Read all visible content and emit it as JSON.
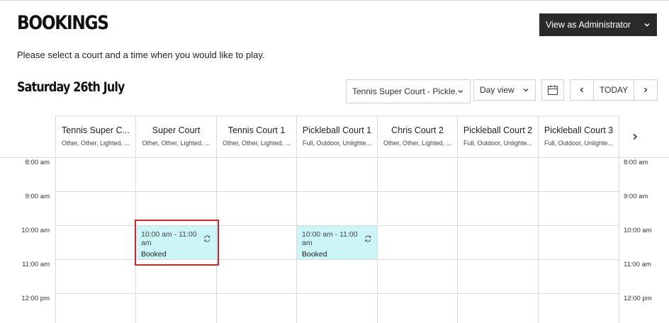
{
  "header": {
    "title": "BOOKINGS",
    "subtitle": "Please select a court and a time when you would like to play.",
    "admin_label": "View as Administrator"
  },
  "toolbar": {
    "date": "Saturday 26th July",
    "court_select_value": "Tennis Super Court - Pickle...",
    "view_select_value": "Day view",
    "today_label": "TODAY",
    "prev_icon": "chevron-left-icon",
    "next_icon": "chevron-right-icon",
    "calendar_icon": "calendar-icon"
  },
  "columns": [
    {
      "name": "Tennis Super C...",
      "meta": "Other, Other, Lighted, ..."
    },
    {
      "name": "Super Court",
      "meta": "Other, Other, Lighted, ..."
    },
    {
      "name": "Tennis Court 1",
      "meta": "Other, Other, Lighted, ..."
    },
    {
      "name": "Pickleball Court 1",
      "meta": "Full, Outdoor, Unlighte..."
    },
    {
      "name": "Chris Court 2",
      "meta": "Other, Other, Lighted, ..."
    },
    {
      "name": "Pickleball Court 2",
      "meta": "Full, Outdoor, Unlighte..."
    },
    {
      "name": "Pickleball Court 3",
      "meta": "Full, Outdoor, Unlighte..."
    }
  ],
  "times": [
    "8:00 am",
    "9:00 am",
    "10:00 am",
    "11:00 am",
    "12:00 pm"
  ],
  "bookings": [
    {
      "time": "10:00 am - 11:00 am",
      "status": "Booked",
      "court": "Super Court"
    },
    {
      "time": "10:00 am - 11:00 am",
      "status": "Booked",
      "court": "Pickleball Court 1"
    }
  ],
  "colors": {
    "booking_bg": "#cbf5f7",
    "highlight": "#d42626",
    "admin_bg": "#2a2a2a"
  }
}
